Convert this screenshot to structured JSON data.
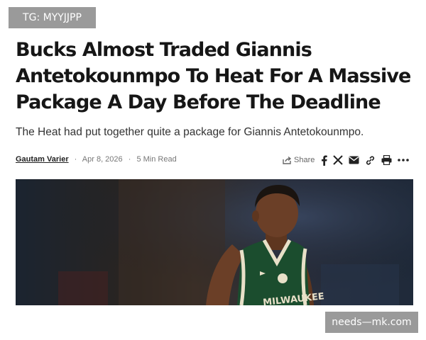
{
  "watermark": {
    "top": "TG: MYYJJPP",
    "bottom": "needs—mk.com"
  },
  "article": {
    "headline_lines": [
      "Bucks Almost Traded Giannis",
      "Antetokounmpo To Heat For A Massive",
      "Package A Day Before The Deadline"
    ],
    "subheadline": "The Heat had put together quite a package for Giannis Antetokounmpo.",
    "author": "Gautam Varier",
    "separator": "·",
    "date": "Apr 8, 2026",
    "read_time": "5 Min Read"
  },
  "share_bar": {
    "share_label": "Share",
    "icons": [
      "share-icon",
      "facebook-icon",
      "x-icon",
      "email-icon",
      "link-icon",
      "print-icon",
      "more-icon"
    ]
  },
  "photo": {
    "jersey_text": "MILWAUKEE",
    "colors": {
      "jersey": "#1b4d2e",
      "jersey_trim": "#e8e0c8",
      "skin": "#6b3f27",
      "background": "#1b2430"
    }
  }
}
